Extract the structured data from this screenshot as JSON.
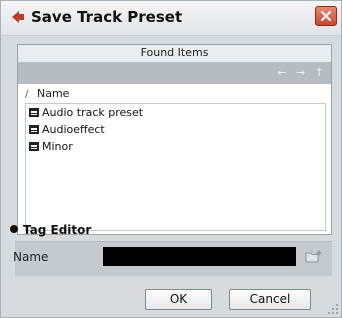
{
  "window": {
    "title": "Save Track Preset",
    "accent": "#c0392b"
  },
  "found_items": {
    "header": "Found Items",
    "nav_arrows": "← → ↑",
    "column_sort": "∕",
    "column_name": "Name",
    "items": [
      {
        "label": "Audio track preset",
        "icon": "preset-list-icon"
      },
      {
        "label": "Audioeffect",
        "icon": "preset-list-icon"
      },
      {
        "label": "Minor",
        "icon": "preset-list-icon"
      }
    ]
  },
  "tag_editor": {
    "title": "Tag Editor",
    "name_label": "Name",
    "name_value": ""
  },
  "buttons": {
    "ok": "OK",
    "cancel": "Cancel"
  }
}
